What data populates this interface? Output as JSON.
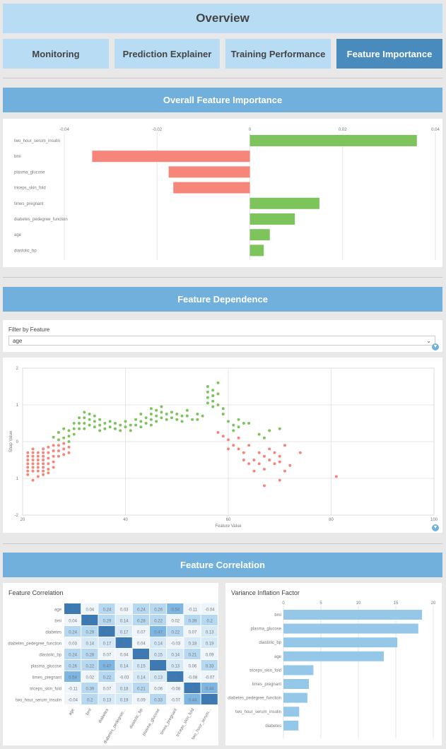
{
  "header": {
    "title": "Overview"
  },
  "tabs": [
    {
      "label": "Monitoring",
      "active": false
    },
    {
      "label": "Prediction Explainer",
      "active": false
    },
    {
      "label": "Training Performance",
      "active": false
    },
    {
      "label": "Feature Importance",
      "active": true
    }
  ],
  "sections": {
    "importance": "Overall Feature Importance",
    "dependence": "Feature Dependence",
    "correlation": "Feature Correlation"
  },
  "colors": {
    "positive": "#7dc45d",
    "negative": "#f6867a",
    "accent": "#71b0dc",
    "active_tab": "#4a8bbd"
  },
  "filter": {
    "label": "Filter by Feature",
    "value": "age"
  },
  "correlation_panel": {
    "title": "Feature Correlation"
  },
  "vif_panel": {
    "title": "Variance Inflation Factor"
  },
  "chart_data": [
    {
      "type": "bar",
      "orientation": "horizontal",
      "categories": [
        "two_hour_serum_insulin",
        "bmi",
        "plasma_glucose",
        "triceps_skin_fold",
        "times_pregnant",
        "diabetes_pedegree_function",
        "age",
        "diastolic_bp"
      ],
      "values": [
        0.036,
        -0.034,
        -0.0175,
        -0.0165,
        0.015,
        0.0097,
        0.0043,
        0.003
      ],
      "xlim": [
        -0.04,
        0.04
      ],
      "xticks": [
        "-0.04",
        "-0.02",
        "0",
        "0.02",
        "0.04"
      ]
    },
    {
      "type": "scatter",
      "xlabel": "Feature Value",
      "ylabel": "Shap Value",
      "xlim": [
        20,
        100
      ],
      "ylim": [
        -2,
        2
      ],
      "xticks": [
        "20",
        "40",
        "60",
        "80",
        "100"
      ],
      "yticks": [
        "2",
        "1",
        "0",
        "1",
        "-2"
      ],
      "points": [
        [
          21,
          -0.3
        ],
        [
          21,
          -0.4
        ],
        [
          21,
          -0.5
        ],
        [
          21,
          -0.6
        ],
        [
          21,
          -0.7
        ],
        [
          21,
          -0.8
        ],
        [
          21,
          -0.9
        ],
        [
          22,
          -0.2
        ],
        [
          22,
          -0.3
        ],
        [
          22,
          -0.4
        ],
        [
          22,
          -0.5
        ],
        [
          22,
          -0.6
        ],
        [
          22,
          -0.7
        ],
        [
          22,
          -0.8
        ],
        [
          22,
          -1.05
        ],
        [
          23,
          -0.3
        ],
        [
          23,
          -0.4
        ],
        [
          23,
          -0.5
        ],
        [
          23,
          -0.6
        ],
        [
          23,
          -0.7
        ],
        [
          23,
          -0.8
        ],
        [
          23,
          -0.95
        ],
        [
          24,
          -0.2
        ],
        [
          24,
          -0.3
        ],
        [
          24,
          -0.4
        ],
        [
          24,
          -0.5
        ],
        [
          24,
          -0.6
        ],
        [
          24,
          -0.7
        ],
        [
          24,
          -0.8
        ],
        [
          24,
          -0.9
        ],
        [
          25,
          -0.15
        ],
        [
          25,
          -0.3
        ],
        [
          25,
          -0.45
        ],
        [
          25,
          -0.6
        ],
        [
          25,
          -0.75
        ],
        [
          25,
          -0.85
        ],
        [
          26,
          -0.1
        ],
        [
          26,
          -0.25
        ],
        [
          26,
          -0.4
        ],
        [
          26,
          -0.55
        ],
        [
          26,
          -0.7
        ],
        [
          27,
          0.05
        ],
        [
          27,
          -0.1
        ],
        [
          27,
          -0.25
        ],
        [
          27,
          -0.4
        ],
        [
          28,
          0.1
        ],
        [
          28,
          -0.05
        ],
        [
          28,
          -0.2
        ],
        [
          28,
          -0.35
        ],
        [
          29,
          0.15
        ],
        [
          29,
          0
        ],
        [
          29,
          -0.15
        ],
        [
          29,
          -0.3
        ],
        [
          26,
          0.12
        ],
        [
          27,
          0.25
        ],
        [
          28,
          0.35
        ],
        [
          29,
          0.3
        ],
        [
          30,
          0.5
        ],
        [
          30,
          0.35
        ],
        [
          30,
          0.2
        ],
        [
          31,
          0.65
        ],
        [
          31,
          0.5
        ],
        [
          31,
          0.35
        ],
        [
          32,
          0.8
        ],
        [
          32,
          0.65
        ],
        [
          32,
          0.5
        ],
        [
          32,
          0.35
        ],
        [
          33,
          0.75
        ],
        [
          33,
          0.6
        ],
        [
          33,
          0.45
        ],
        [
          34,
          0.7
        ],
        [
          34,
          0.55
        ],
        [
          34,
          0.4
        ],
        [
          35,
          0.6
        ],
        [
          35,
          0.45
        ],
        [
          35,
          0.3
        ],
        [
          36,
          0.5
        ],
        [
          36,
          0.35
        ],
        [
          37,
          0.55
        ],
        [
          37,
          0.4
        ],
        [
          38,
          0.5
        ],
        [
          38,
          0.35
        ],
        [
          39,
          0.45
        ],
        [
          39,
          0.3
        ],
        [
          40,
          0.55
        ],
        [
          40,
          0.4
        ],
        [
          41,
          0.45
        ],
        [
          41,
          0.3
        ],
        [
          42,
          0.6
        ],
        [
          42,
          0.45
        ],
        [
          43,
          0.75
        ],
        [
          43,
          0.55
        ],
        [
          43,
          0.4
        ],
        [
          44,
          0.65
        ],
        [
          44,
          0.5
        ],
        [
          45,
          0.9
        ],
        [
          45,
          0.75
        ],
        [
          45,
          0.6
        ],
        [
          45,
          0.45
        ],
        [
          46,
          0.85
        ],
        [
          46,
          0.7
        ],
        [
          46,
          0.55
        ],
        [
          47,
          0.95
        ],
        [
          47,
          0.8
        ],
        [
          47,
          0.65
        ],
        [
          48,
          0.75
        ],
        [
          48,
          0.6
        ],
        [
          49,
          0.8
        ],
        [
          49,
          0.65
        ],
        [
          50,
          0.75
        ],
        [
          50,
          0.6
        ],
        [
          51,
          0.7
        ],
        [
          51,
          0.55
        ],
        [
          52,
          0.85
        ],
        [
          52,
          0.7
        ],
        [
          53,
          0.6
        ],
        [
          54,
          0.75
        ],
        [
          54,
          0.6
        ],
        [
          55,
          0.7
        ],
        [
          56,
          1.5
        ],
        [
          56,
          1.35
        ],
        [
          56,
          1.2
        ],
        [
          56,
          1.05
        ],
        [
          57,
          1.4
        ],
        [
          57,
          1.25
        ],
        [
          57,
          1.1
        ],
        [
          57,
          0.95
        ],
        [
          58,
          1.6
        ],
        [
          58,
          1.3
        ],
        [
          58,
          1.0
        ],
        [
          59,
          0.9
        ],
        [
          59,
          0.75
        ],
        [
          60,
          0.55
        ],
        [
          61,
          0.45
        ],
        [
          61,
          0.3
        ],
        [
          62,
          0.6
        ],
        [
          62,
          0.4
        ],
        [
          63,
          0.5
        ],
        [
          64,
          0.5
        ],
        [
          66,
          0.2
        ],
        [
          67,
          0.1
        ],
        [
          68,
          0.3
        ],
        [
          70,
          0.35
        ]
      ],
      "negative_points": [
        [
          58,
          0.25
        ],
        [
          59,
          0.15
        ],
        [
          60,
          0.05
        ],
        [
          60,
          -0.2
        ],
        [
          61,
          -0.1
        ],
        [
          62,
          0.1
        ],
        [
          62,
          -0.2
        ],
        [
          63,
          -0.3
        ],
        [
          63,
          -0.5
        ],
        [
          64,
          -0.1
        ],
        [
          64,
          -0.6
        ],
        [
          65,
          -0.8
        ],
        [
          66,
          -0.3
        ],
        [
          66,
          -0.6
        ],
        [
          67,
          -0.4
        ],
        [
          67,
          -0.75
        ],
        [
          68,
          -0.2
        ],
        [
          68,
          -0.5
        ],
        [
          69,
          -0.3
        ],
        [
          69,
          -0.6
        ],
        [
          70,
          -0.4
        ],
        [
          70,
          -0.55
        ],
        [
          70,
          -1.05
        ],
        [
          71,
          -0.1
        ],
        [
          71,
          -0.8
        ],
        [
          72,
          -0.65
        ],
        [
          74,
          -0.3
        ],
        [
          81,
          -0.95
        ],
        [
          67,
          -1.2
        ],
        [
          65,
          -0.5
        ]
      ]
    },
    {
      "type": "heatmap",
      "rows": [
        "age",
        "bmi",
        "diabetes",
        "diabetes_pedegree_function",
        "diastolic_bp",
        "plasma_glucose",
        "times_pregnant",
        "triceps_skin_fold",
        "two_hour_serum_insulin"
      ],
      "cols": [
        "age",
        "bmi",
        "diabetes",
        "diabetes_pedegree...",
        "diastolic_bp",
        "plasma_glucose",
        "times_pregnant",
        "triceps_skin_fold",
        "two_hour_serum..."
      ],
      "values": [
        [
          "1",
          "0.04",
          "0.24",
          "0.03",
          "0.24",
          "0.26",
          "0.54",
          "-0.11",
          "-0.04"
        ],
        [
          "0.04",
          "1",
          "0.29",
          "0.14",
          "0.28",
          "0.22",
          "0.02",
          "0.39",
          "0.2"
        ],
        [
          "0.24",
          "0.29",
          "1",
          "0.17",
          "0.07",
          "0.47",
          "0.22",
          "0.07",
          "0.13"
        ],
        [
          "0.03",
          "0.14",
          "0.17",
          "1",
          "0.04",
          "0.14",
          "-0.03",
          "0.18",
          "0.19"
        ],
        [
          "0.24",
          "0.28",
          "0.07",
          "0.04",
          "1",
          "0.15",
          "0.14",
          "0.21",
          "0.09"
        ],
        [
          "0.26",
          "0.22",
          "0.47",
          "0.14",
          "0.15",
          "1",
          "0.13",
          "0.06",
          "0.33"
        ],
        [
          "0.54",
          "0.02",
          "0.22",
          "-0.03",
          "0.14",
          "0.13",
          "1",
          "-0.08",
          "-0.07"
        ],
        [
          "-0.11",
          "0.39",
          "0.07",
          "0.18",
          "0.21",
          "0.06",
          "-0.08",
          "1",
          "0.44"
        ],
        [
          "-0.04",
          "0.2",
          "0.13",
          "0.19",
          "0.09",
          "0.33",
          "-0.07",
          "0.44",
          "1"
        ]
      ]
    },
    {
      "type": "bar",
      "orientation": "horizontal",
      "categories": [
        "bmi",
        "plasma_glucose",
        "diastolic_bp",
        "age",
        "triceps_skin_fold",
        "times_pregnant",
        "diabetes_pedegree_function",
        "two_hour_serum_insulin",
        "diabetes"
      ],
      "values": [
        18.5,
        18.0,
        15.2,
        13.4,
        4.0,
        3.4,
        3.2,
        2.1,
        2.0
      ],
      "xlim": [
        0,
        20
      ],
      "xticks": [
        "0",
        "5",
        "10",
        "15",
        "20"
      ]
    }
  ]
}
